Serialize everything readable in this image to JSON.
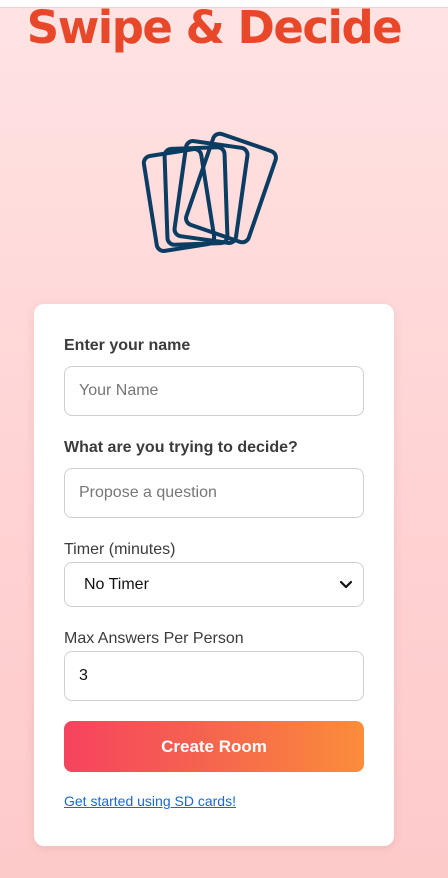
{
  "app": {
    "title": "Swipe & Decide"
  },
  "icons": {
    "logo": "cards-stack-icon",
    "select_arrow": "chevron-down-icon"
  },
  "colors": {
    "brand": "#e8472a",
    "icon": "#0b3d62",
    "button_start": "#f6435f",
    "button_end": "#fb8d3a",
    "link": "#1a66d6"
  },
  "form": {
    "name_label": "Enter your name",
    "name_placeholder": "Your Name",
    "question_label": "What are you trying to decide?",
    "question_placeholder": "Propose a question",
    "timer_label": "Timer (minutes)",
    "timer_value": "No Timer",
    "max_label": "Max Answers Per Person",
    "max_value": "3",
    "create_button": "Create Room",
    "help_link": "Get started using SD cards!"
  }
}
